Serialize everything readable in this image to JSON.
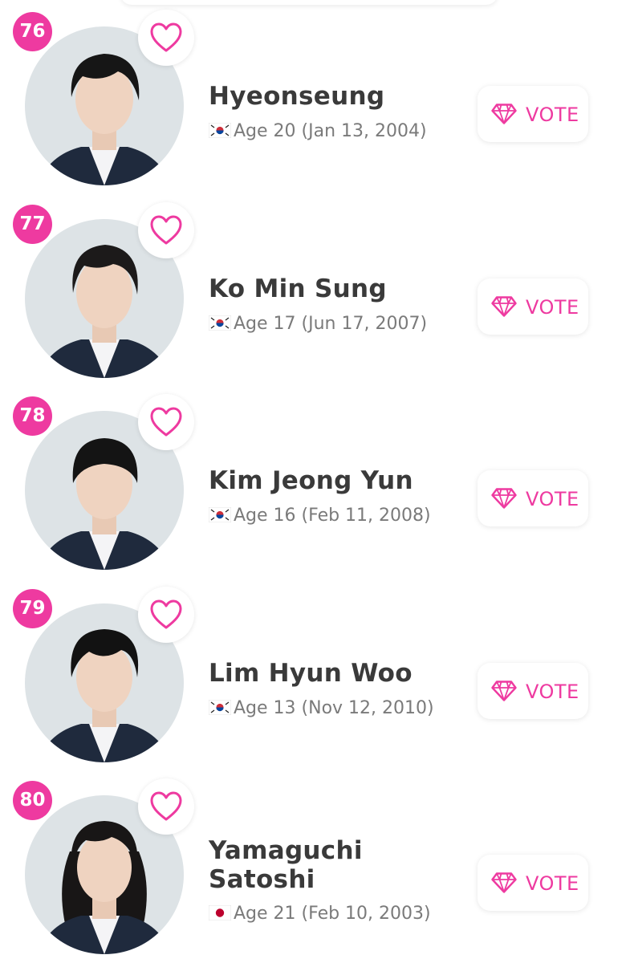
{
  "colors": {
    "accent": "#ee3aa0",
    "name_text": "#3a3a3a",
    "meta_text": "#7a7a7a"
  },
  "vote_label": "VOTE",
  "contestants": [
    {
      "rank": "76",
      "name": "Hyeonseung",
      "flag": "korea-flag-icon",
      "details": "Age 20 (Jan 13, 2004)"
    },
    {
      "rank": "77",
      "name": "Ko Min Sung",
      "flag": "korea-flag-icon",
      "details": "Age 17 (Jun 17, 2007)"
    },
    {
      "rank": "78",
      "name": "Kim Jeong Yun",
      "flag": "korea-flag-icon",
      "details": "Age 16 (Feb 11, 2008)"
    },
    {
      "rank": "79",
      "name": "Lim Hyun Woo",
      "flag": "korea-flag-icon",
      "details": "Age 13 (Nov 12, 2010)"
    },
    {
      "rank": "80",
      "name": "Yamaguchi Satoshi",
      "flag": "japan-flag-icon",
      "details": "Age 21 (Feb 10, 2003)"
    }
  ]
}
